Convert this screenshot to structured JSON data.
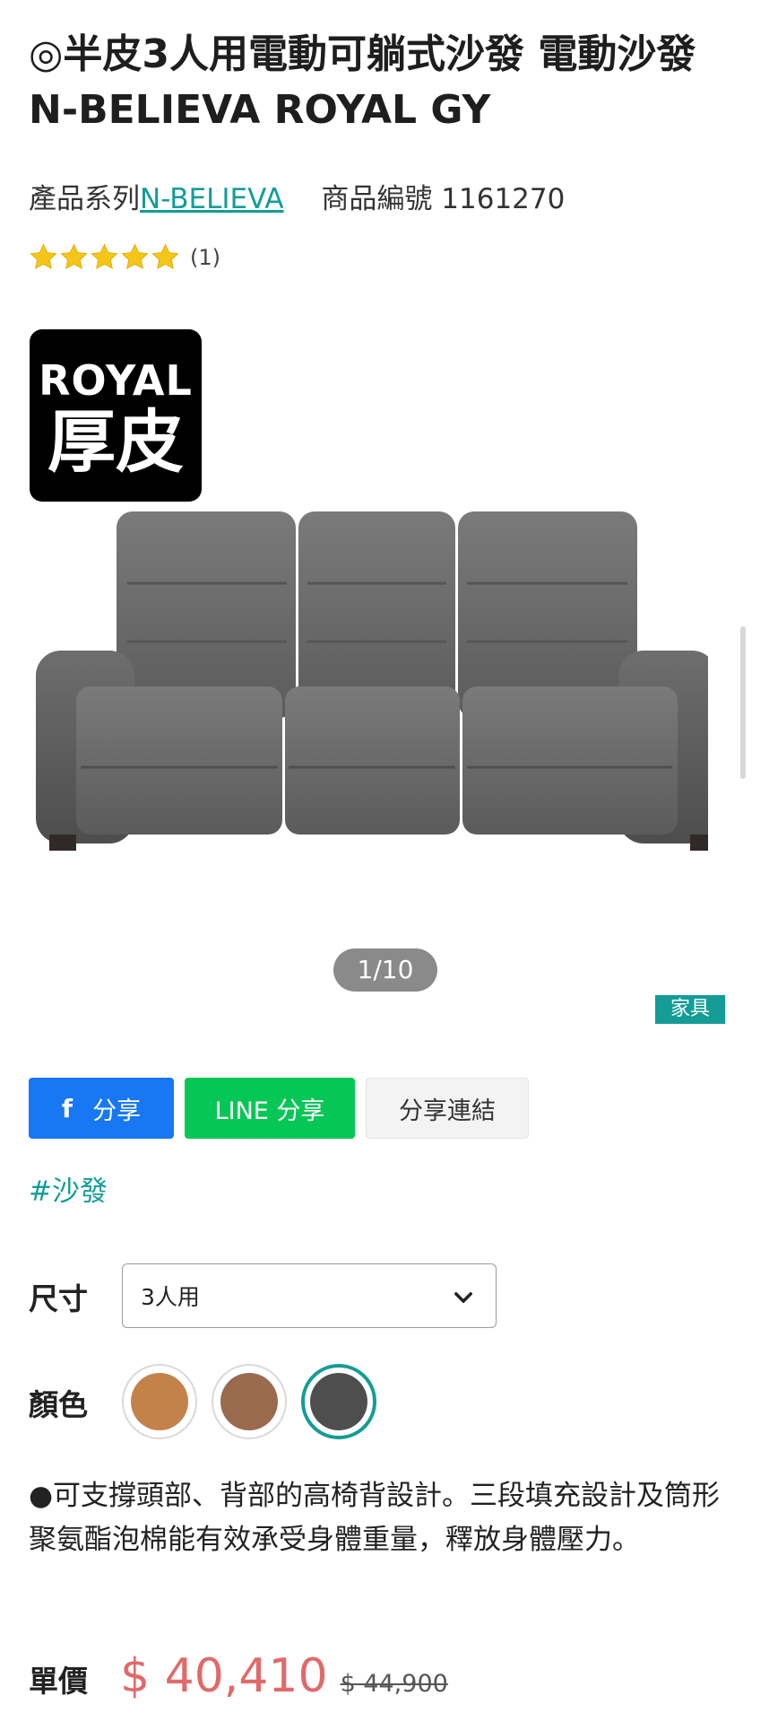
{
  "product": {
    "title": "◎半皮3人用電動可躺式沙發 電動沙發 N-BELIEVA ROYAL GY",
    "series_label": "產品系列",
    "series_link": "N-BELIEVA",
    "code_label": "商品編號",
    "code": "1161270",
    "rating": {
      "stars": 5,
      "count_text": "(1)"
    },
    "badge": {
      "line1": "ROYAL",
      "line2": "厚皮"
    },
    "gallery_counter": "1/10",
    "category_tag": "家具"
  },
  "share": {
    "facebook_icon_text": "f",
    "facebook_label": "分享",
    "line_label": "LINE 分享",
    "link_label": "分享連結"
  },
  "hashtag": "#沙發",
  "options": {
    "size_label": "尺寸",
    "size_value": "3人用",
    "color_label": "顏色",
    "colors": [
      {
        "name": "tan",
        "hex": "#c3824a",
        "selected": false
      },
      {
        "name": "brown",
        "hex": "#9a6a4f",
        "selected": false
      },
      {
        "name": "gray",
        "hex": "#4e4e4e",
        "selected": true
      }
    ]
  },
  "description": "●可支撐頭部、背部的高椅背設計。三段填充設計及筒形聚氨酯泡棉能有效承受身體重量，釋放身體壓力。",
  "price": {
    "label": "單價",
    "current": "$ 40,410",
    "original": "$ 44,900"
  },
  "colors": {
    "accent": "#139d96",
    "price": "#e06a6a",
    "facebook": "#1877f2",
    "line": "#06c755",
    "star": "#f5c518"
  }
}
